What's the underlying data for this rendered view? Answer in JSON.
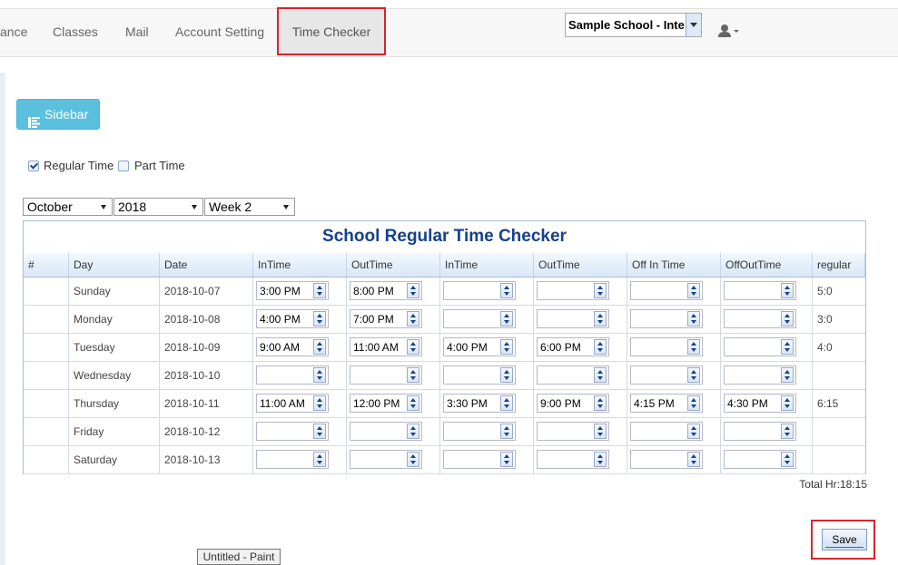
{
  "nav": {
    "items": [
      {
        "label": "ance"
      },
      {
        "label": "Classes"
      },
      {
        "label": "Mail"
      },
      {
        "label": "Account Setting"
      },
      {
        "label": "Time Checker"
      }
    ],
    "school_select": "Sample School - International",
    "user_icon": "user-icon"
  },
  "sidebar_button": {
    "label": "Sidebar",
    "icon": "list-icon"
  },
  "filters": {
    "regular_time": {
      "label": "Regular Time",
      "checked": true
    },
    "part_time": {
      "label": "Part Time",
      "checked": false
    },
    "month": "October",
    "year": "2018",
    "week": "Week 2"
  },
  "grid": {
    "title": "School Regular Time Checker",
    "columns": [
      "#",
      "Day",
      "Date",
      "InTime",
      "OutTime",
      "InTime",
      "OutTime",
      "Off In Time",
      "OffOutTime",
      "regular"
    ],
    "rows": [
      {
        "day": "Sunday",
        "date": "2018-10-07",
        "times": [
          "3:00 PM",
          "8:00 PM",
          "",
          "",
          "",
          ""
        ],
        "regular": "5:0"
      },
      {
        "day": "Monday",
        "date": "2018-10-08",
        "times": [
          "4:00 PM",
          "7:00 PM",
          "",
          "",
          "",
          ""
        ],
        "regular": "3:0"
      },
      {
        "day": "Tuesday",
        "date": "2018-10-09",
        "times": [
          "9:00 AM",
          "11:00 AM",
          "4:00 PM",
          "6:00 PM",
          "",
          ""
        ],
        "regular": "4:0"
      },
      {
        "day": "Wednesday",
        "date": "2018-10-10",
        "times": [
          "",
          "",
          "",
          "",
          "",
          ""
        ],
        "regular": ""
      },
      {
        "day": "Thursday",
        "date": "2018-10-11",
        "times": [
          "11:00 AM",
          "12:00 PM",
          "3:30 PM",
          "9:00 PM",
          "4:15 PM",
          "4:30 PM"
        ],
        "regular": "6:15"
      },
      {
        "day": "Friday",
        "date": "2018-10-12",
        "times": [
          "",
          "",
          "",
          "",
          "",
          ""
        ],
        "regular": ""
      },
      {
        "day": "Saturday",
        "date": "2018-10-13",
        "times": [
          "",
          "",
          "",
          "",
          "",
          ""
        ],
        "regular": ""
      }
    ]
  },
  "total": "Total Hr:18:15",
  "save_label": "Save",
  "taskbar_tooltip": "Untitled - Paint",
  "colors": {
    "accent": "#5bc0de",
    "title": "#15428b",
    "highlight": "#d9232b"
  }
}
